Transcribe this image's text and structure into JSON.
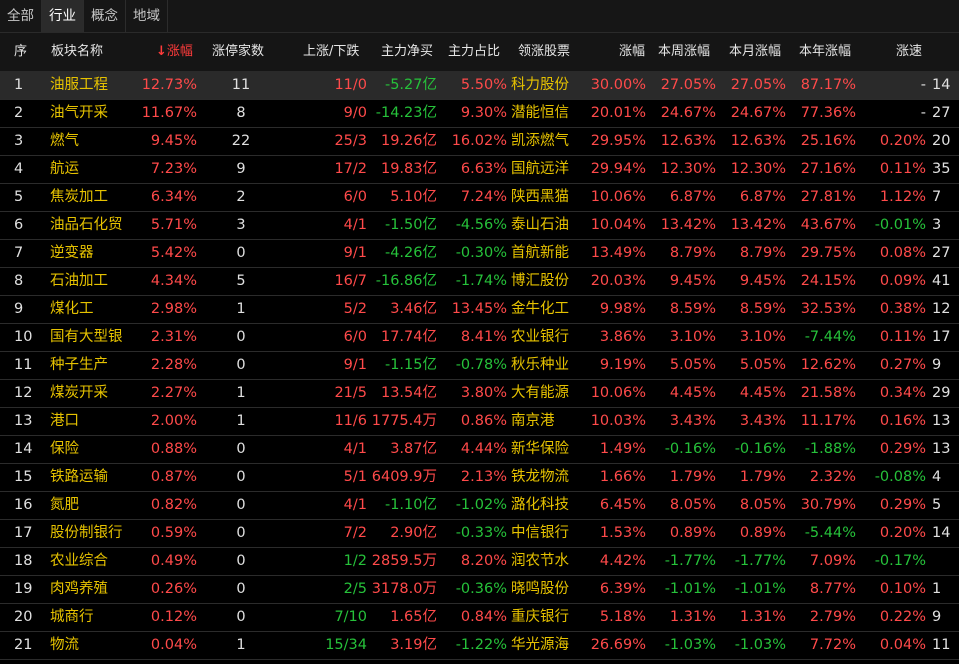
{
  "tabs": [
    "全部",
    "行业",
    "概念",
    "地域"
  ],
  "active_tab": 1,
  "headers": {
    "seq": "序",
    "name": "板块名称",
    "change": "涨幅",
    "sort_arrow": "↓",
    "limit_up": "涨停家数",
    "up_down": "上涨/下跌",
    "net_inflow": "主力净买",
    "main_ratio": "主力占比",
    "leader": "领涨股票",
    "leader_change": "涨幅",
    "week": "本周涨幅",
    "month": "本月涨幅",
    "year": "本年涨幅",
    "speed": "涨速",
    "extra": ""
  },
  "rows": [
    {
      "seq": "1",
      "name": "油服工程",
      "change": "12.73%",
      "limit_up": "11",
      "up_down": "11/0",
      "net": "-5.27亿",
      "ratio": "5.50%",
      "leader": "科力股份",
      "leader_change": "30.00%",
      "week": "27.05%",
      "month": "27.05%",
      "year": "87.17%",
      "speed": "-",
      "extra": "14"
    },
    {
      "seq": "2",
      "name": "油气开采",
      "change": "11.67%",
      "limit_up": "8",
      "up_down": "9/0",
      "net": "-14.23亿",
      "ratio": "9.30%",
      "leader": "潜能恒信",
      "leader_change": "20.01%",
      "week": "24.67%",
      "month": "24.67%",
      "year": "77.36%",
      "speed": "-",
      "extra": "27"
    },
    {
      "seq": "3",
      "name": "燃气",
      "change": "9.45%",
      "limit_up": "22",
      "up_down": "25/3",
      "net": "19.26亿",
      "ratio": "16.02%",
      "leader": "凯添燃气",
      "leader_change": "29.95%",
      "week": "12.63%",
      "month": "12.63%",
      "year": "25.16%",
      "speed": "0.20%",
      "extra": "20"
    },
    {
      "seq": "4",
      "name": "航运",
      "change": "7.23%",
      "limit_up": "9",
      "up_down": "17/2",
      "net": "19.83亿",
      "ratio": "6.63%",
      "leader": "国航远洋",
      "leader_change": "29.94%",
      "week": "12.30%",
      "month": "12.30%",
      "year": "27.16%",
      "speed": "0.11%",
      "extra": "35"
    },
    {
      "seq": "5",
      "name": "焦炭加工",
      "change": "6.34%",
      "limit_up": "2",
      "up_down": "6/0",
      "net": "5.10亿",
      "ratio": "7.24%",
      "leader": "陕西黑猫",
      "leader_change": "10.06%",
      "week": "6.87%",
      "month": "6.87%",
      "year": "27.81%",
      "speed": "1.12%",
      "extra": "7"
    },
    {
      "seq": "6",
      "name": "油品石化贸",
      "change": "5.71%",
      "limit_up": "3",
      "up_down": "4/1",
      "net": "-1.50亿",
      "ratio": "-4.56%",
      "leader": "泰山石油",
      "leader_change": "10.04%",
      "week": "13.42%",
      "month": "13.42%",
      "year": "43.67%",
      "speed": "-0.01%",
      "extra": "3"
    },
    {
      "seq": "7",
      "name": "逆变器",
      "change": "5.42%",
      "limit_up": "0",
      "up_down": "9/1",
      "net": "-4.26亿",
      "ratio": "-0.30%",
      "leader": "首航新能",
      "leader_change": "13.49%",
      "week": "8.79%",
      "month": "8.79%",
      "year": "29.75%",
      "speed": "0.08%",
      "extra": "27"
    },
    {
      "seq": "8",
      "name": "石油加工",
      "change": "4.34%",
      "limit_up": "5",
      "up_down": "16/7",
      "net": "-16.86亿",
      "ratio": "-1.74%",
      "leader": "博汇股份",
      "leader_change": "20.03%",
      "week": "9.45%",
      "month": "9.45%",
      "year": "24.15%",
      "speed": "0.09%",
      "extra": "41"
    },
    {
      "seq": "9",
      "name": "煤化工",
      "change": "2.98%",
      "limit_up": "1",
      "up_down": "5/2",
      "net": "3.46亿",
      "ratio": "13.45%",
      "leader": "金牛化工",
      "leader_change": "9.98%",
      "week": "8.59%",
      "month": "8.59%",
      "year": "32.53%",
      "speed": "0.38%",
      "extra": "12"
    },
    {
      "seq": "10",
      "name": "国有大型银",
      "change": "2.31%",
      "limit_up": "0",
      "up_down": "6/0",
      "net": "17.74亿",
      "ratio": "8.41%",
      "leader": "农业银行",
      "leader_change": "3.86%",
      "week": "3.10%",
      "month": "3.10%",
      "year": "-7.44%",
      "speed": "0.11%",
      "extra": "17"
    },
    {
      "seq": "11",
      "name": "种子生产",
      "change": "2.28%",
      "limit_up": "0",
      "up_down": "9/1",
      "net": "-1.15亿",
      "ratio": "-0.78%",
      "leader": "秋乐种业",
      "leader_change": "9.19%",
      "week": "5.05%",
      "month": "5.05%",
      "year": "12.62%",
      "speed": "0.27%",
      "extra": "9"
    },
    {
      "seq": "12",
      "name": "煤炭开采",
      "change": "2.27%",
      "limit_up": "1",
      "up_down": "21/5",
      "net": "13.54亿",
      "ratio": "3.80%",
      "leader": "大有能源",
      "leader_change": "10.06%",
      "week": "4.45%",
      "month": "4.45%",
      "year": "21.58%",
      "speed": "0.34%",
      "extra": "29"
    },
    {
      "seq": "13",
      "name": "港口",
      "change": "2.00%",
      "limit_up": "1",
      "up_down": "11/6",
      "net": "1775.4万",
      "ratio": "0.86%",
      "leader": "南京港",
      "leader_change": "10.03%",
      "week": "3.43%",
      "month": "3.43%",
      "year": "11.17%",
      "speed": "0.16%",
      "extra": "13"
    },
    {
      "seq": "14",
      "name": "保险",
      "change": "0.88%",
      "limit_up": "0",
      "up_down": "4/1",
      "net": "3.87亿",
      "ratio": "4.44%",
      "leader": "新华保险",
      "leader_change": "1.49%",
      "week": "-0.16%",
      "month": "-0.16%",
      "year": "-1.88%",
      "speed": "0.29%",
      "extra": "13"
    },
    {
      "seq": "15",
      "name": "铁路运输",
      "change": "0.87%",
      "limit_up": "0",
      "up_down": "5/1",
      "net": "6409.9万",
      "ratio": "2.13%",
      "leader": "铁龙物流",
      "leader_change": "1.66%",
      "week": "1.79%",
      "month": "1.79%",
      "year": "2.32%",
      "speed": "-0.08%",
      "extra": "4"
    },
    {
      "seq": "16",
      "name": "氮肥",
      "change": "0.82%",
      "limit_up": "0",
      "up_down": "4/1",
      "net": "-1.10亿",
      "ratio": "-1.02%",
      "leader": "潞化科技",
      "leader_change": "6.45%",
      "week": "8.05%",
      "month": "8.05%",
      "year": "30.79%",
      "speed": "0.29%",
      "extra": "5"
    },
    {
      "seq": "17",
      "name": "股份制银行",
      "change": "0.59%",
      "limit_up": "0",
      "up_down": "7/2",
      "net": "2.90亿",
      "ratio": "-0.33%",
      "leader": "中信银行",
      "leader_change": "1.53%",
      "week": "0.89%",
      "month": "0.89%",
      "year": "-5.44%",
      "speed": "0.20%",
      "extra": "14"
    },
    {
      "seq": "18",
      "name": "农业综合",
      "change": "0.49%",
      "limit_up": "0",
      "up_down": "1/2",
      "net": "2859.5万",
      "ratio": "8.20%",
      "leader": "润农节水",
      "leader_change": "4.42%",
      "week": "-1.77%",
      "month": "-1.77%",
      "year": "7.09%",
      "speed": "-0.17%",
      "extra": ""
    },
    {
      "seq": "19",
      "name": "肉鸡养殖",
      "change": "0.26%",
      "limit_up": "0",
      "up_down": "2/5",
      "net": "3178.0万",
      "ratio": "-0.36%",
      "leader": "晓鸣股份",
      "leader_change": "6.39%",
      "week": "-1.01%",
      "month": "-1.01%",
      "year": "8.77%",
      "speed": "0.10%",
      "extra": "1"
    },
    {
      "seq": "20",
      "name": "城商行",
      "change": "0.12%",
      "limit_up": "0",
      "up_down": "7/10",
      "net": "1.65亿",
      "ratio": "0.84%",
      "leader": "重庆银行",
      "leader_change": "5.18%",
      "week": "1.31%",
      "month": "1.31%",
      "year": "2.79%",
      "speed": "0.22%",
      "extra": "9"
    },
    {
      "seq": "21",
      "name": "物流",
      "change": "0.04%",
      "limit_up": "1",
      "up_down": "15/34",
      "net": "3.19亿",
      "ratio": "-1.22%",
      "leader": "华光源海",
      "leader_change": "26.69%",
      "week": "-1.03%",
      "month": "-1.03%",
      "year": "7.72%",
      "speed": "0.04%",
      "extra": "11"
    }
  ],
  "colors": {
    "up": "#ff4a4a",
    "down": "#26c13a",
    "name": "#e6c200",
    "neutral": "#e0e0e0"
  }
}
